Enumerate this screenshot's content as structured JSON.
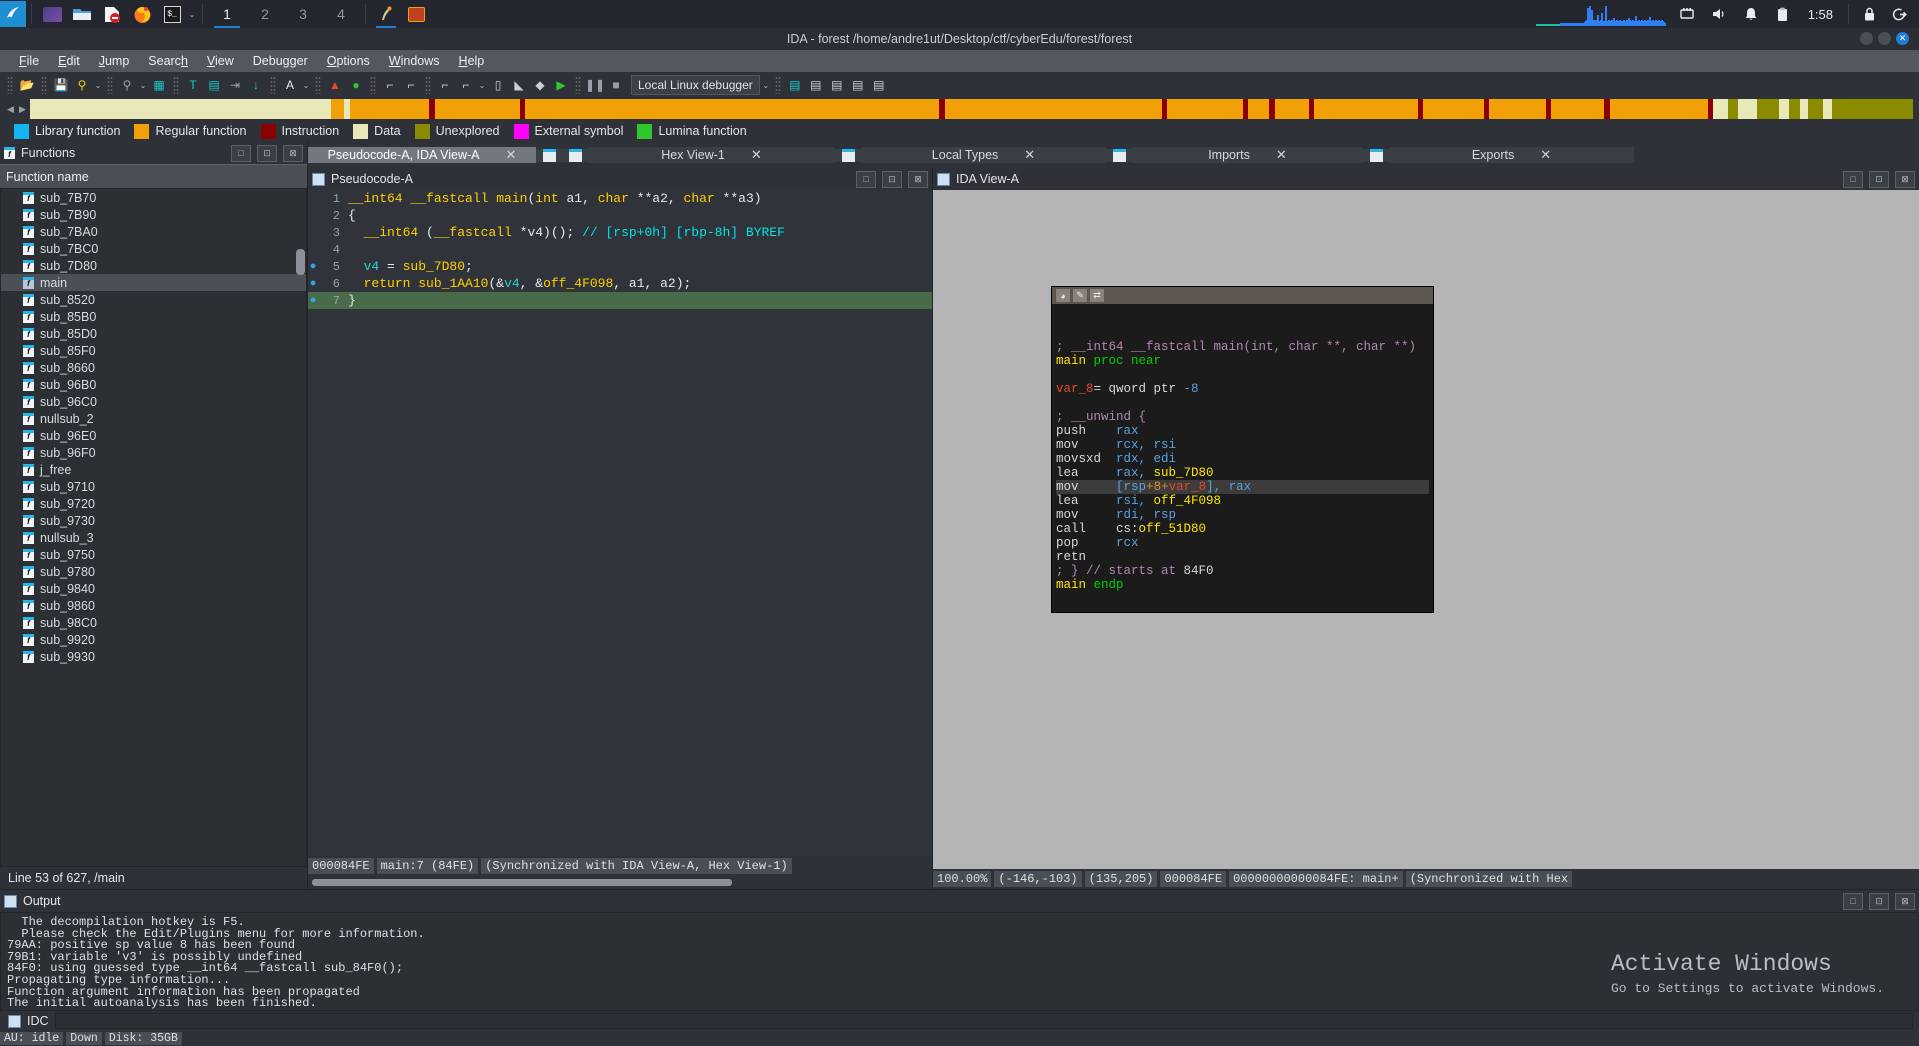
{
  "taskbar": {
    "logo_icon": "kali-dragon-icon",
    "launchers": [
      {
        "name": "terminal-emulator-icon",
        "glyph": "▭"
      },
      {
        "name": "file-manager-icon",
        "glyph": "📁"
      },
      {
        "name": "text-editor-icon",
        "glyph": "📄"
      },
      {
        "name": "firefox-icon",
        "glyph": "🦊"
      },
      {
        "name": "terminal-icon",
        "glyph": "$_"
      }
    ],
    "dropdown_caret": "⌄",
    "workspaces": [
      "1",
      "2",
      "3",
      "4"
    ],
    "active_workspace": "1",
    "app_windows": [
      {
        "name": "ida-window-icon",
        "glyph": "🦅"
      },
      {
        "name": "terminal-window-icon",
        "glyph": "▣"
      }
    ],
    "tray": [
      {
        "name": "network-icon",
        "glyph": "🖧"
      },
      {
        "name": "volume-icon",
        "glyph": "🔊"
      },
      {
        "name": "notifications-bell-icon",
        "glyph": "🔔"
      },
      {
        "name": "clipboard-icon",
        "glyph": "📋"
      }
    ],
    "clock": "1:58",
    "lock_icon": "🔒",
    "logout_icon": "⏻"
  },
  "window": {
    "title": "IDA - forest /home/andre1ut/Desktop/ctf/cyberEdu/forest/forest",
    "minimize": "−",
    "maximize": "□",
    "close": "✕"
  },
  "menu": [
    {
      "label": "File",
      "mnemonic": "F"
    },
    {
      "label": "Edit",
      "mnemonic": "E"
    },
    {
      "label": "Jump",
      "mnemonic": "J"
    },
    {
      "label": "Search",
      "mnemonic": "h"
    },
    {
      "label": "View",
      "mnemonic": "V"
    },
    {
      "label": "Debugger",
      "mnemonic": "g"
    },
    {
      "label": "Options",
      "mnemonic": "O"
    },
    {
      "label": "Windows",
      "mnemonic": "W"
    },
    {
      "label": "Help",
      "mnemonic": "H"
    }
  ],
  "toolbar": {
    "debugger_selector": "Local Linux debugger",
    "items": [
      {
        "name": "open-file-icon",
        "glyph": "📂",
        "color": "#e8a317"
      },
      {
        "name": "save-file-icon",
        "glyph": "💾",
        "color": "#29b6e8"
      },
      {
        "name": "navigate-back-icon",
        "glyph": "⚲",
        "color": "#e8d017"
      },
      {
        "name": "navigate-forward-icon",
        "glyph": "⚲",
        "color": "#9aa0aa"
      },
      {
        "name": "hex-view-icon",
        "glyph": "▦",
        "color": "#17c8c8"
      },
      {
        "name": "text-view-icon",
        "glyph": "T",
        "color": "#17c8c8"
      },
      {
        "name": "structures-icon",
        "glyph": "▤",
        "color": "#17c8c8"
      },
      {
        "name": "exports-icon",
        "glyph": "⇥",
        "color": "#9aa0aa"
      },
      {
        "name": "jump-down-icon",
        "glyph": "↓",
        "color": "#17c8c8"
      },
      {
        "name": "font-icon",
        "glyph": "A",
        "color": "#e8ecf2"
      },
      {
        "name": "breakpoint-icon",
        "glyph": "▲",
        "color": "#e04b2a"
      },
      {
        "name": "run-to-icon",
        "glyph": "●",
        "color": "#2ec82e"
      },
      {
        "name": "step-into-icon",
        "glyph": "⌐",
        "color": "#c9ced6"
      },
      {
        "name": "step-over-icon",
        "glyph": "⌐",
        "color": "#c9ced6"
      },
      {
        "name": "step-out-icon",
        "glyph": "⌐",
        "color": "#c9ced6"
      },
      {
        "name": "run-until-return-icon",
        "glyph": "⌐",
        "color": "#c9ced6"
      },
      {
        "name": "stack-frame-icon",
        "glyph": "▯",
        "color": "#c9ced6"
      },
      {
        "name": "edit-function-icon",
        "glyph": "◣",
        "color": "#c9ced6"
      },
      {
        "name": "xrefs-icon",
        "glyph": "◆",
        "color": "#c9ced6"
      },
      {
        "name": "run-debugger-icon",
        "glyph": "▶",
        "color": "#2ec82e"
      },
      {
        "name": "pause-debugger-icon",
        "glyph": "❚❚",
        "color": "#9aa0aa"
      },
      {
        "name": "stop-debugger-icon",
        "glyph": "■",
        "color": "#9aa0aa"
      }
    ],
    "trailing": [
      {
        "name": "watch-view-icon",
        "glyph": "▤",
        "color": "#17c8c8"
      },
      {
        "name": "module-list-icon",
        "glyph": "▤",
        "color": "#c9ced6"
      },
      {
        "name": "threads-icon",
        "glyph": "▤",
        "color": "#c9ced6"
      },
      {
        "name": "segments-icon",
        "glyph": "▤",
        "color": "#c9ced6"
      },
      {
        "name": "options-icon",
        "glyph": "▤",
        "color": "#c9ced6"
      }
    ]
  },
  "navband": {
    "left_arrow": "◀",
    "right_arrow": "▶",
    "segments": [
      {
        "color": "#e8e8b8",
        "width": 16.0
      },
      {
        "color": "#f2a007",
        "width": 0.7
      },
      {
        "color": "#e8e8b8",
        "width": 0.3
      },
      {
        "color": "#f2a007",
        "width": 4.2
      },
      {
        "color": "#8b0000",
        "width": 0.3
      },
      {
        "color": "#f2a007",
        "width": 4.5
      },
      {
        "color": "#8b0000",
        "width": 0.3
      },
      {
        "color": "#f2a007",
        "width": 22.0
      },
      {
        "color": "#8b0000",
        "width": 0.3
      },
      {
        "color": "#f2a007",
        "width": 11.5
      },
      {
        "color": "#8b0000",
        "width": 0.3
      },
      {
        "color": "#f2a007",
        "width": 4.0
      },
      {
        "color": "#8b0000",
        "width": 0.3
      },
      {
        "color": "#f2a007",
        "width": 1.1
      },
      {
        "color": "#8b0000",
        "width": 0.3
      },
      {
        "color": "#f2a007",
        "width": 1.8
      },
      {
        "color": "#8b0000",
        "width": 0.3
      },
      {
        "color": "#f2a007",
        "width": 5.5
      },
      {
        "color": "#8b0000",
        "width": 0.3
      },
      {
        "color": "#f2a007",
        "width": 3.2
      },
      {
        "color": "#8b0000",
        "width": 0.3
      },
      {
        "color": "#f2a007",
        "width": 3.0
      },
      {
        "color": "#8b0000",
        "width": 0.3
      },
      {
        "color": "#f2a007",
        "width": 2.8
      },
      {
        "color": "#8b0000",
        "width": 0.3
      },
      {
        "color": "#f2a007",
        "width": 5.2
      },
      {
        "color": "#8b0000",
        "width": 0.3
      },
      {
        "color": "#e8e8b8",
        "width": 0.8
      },
      {
        "color": "#8b8b00",
        "width": 0.5
      },
      {
        "color": "#e8e8b8",
        "width": 1.0
      },
      {
        "color": "#8b8b00",
        "width": 1.2
      },
      {
        "color": "#e8e8b8",
        "width": 0.5
      },
      {
        "color": "#8b8b00",
        "width": 0.6
      },
      {
        "color": "#e8e8b8",
        "width": 0.4
      },
      {
        "color": "#8b8b00",
        "width": 0.8
      },
      {
        "color": "#e8e8b8",
        "width": 0.5
      },
      {
        "color": "#8b8b00",
        "width": 9.0
      },
      {
        "color": "#e8e8b8",
        "width": 0.4
      },
      {
        "color": "#8b8b00",
        "width": 0.7
      },
      {
        "color": "#e8e8b8",
        "width": 0.3
      },
      {
        "color": "#8b8b00",
        "width": 0.6
      },
      {
        "color": "#e8e8b8",
        "width": 0.9
      },
      {
        "color": "#8b8b00",
        "width": 0.5
      },
      {
        "color": "#ff00ff",
        "width": 0.6
      },
      {
        "color": "#2e3137",
        "width": 50.0
      }
    ],
    "cursor_pos_pct": 22.6
  },
  "legend": [
    {
      "label": "Library function",
      "color": "#12b5f0"
    },
    {
      "label": "Regular function",
      "color": "#f2a007"
    },
    {
      "label": "Instruction",
      "color": "#8b0000"
    },
    {
      "label": "Data",
      "color": "#e8e8b8"
    },
    {
      "label": "Unexplored",
      "color": "#8b8b00"
    },
    {
      "label": "External symbol",
      "color": "#ff00ff"
    },
    {
      "label": "Lumina function",
      "color": "#2ec82e"
    }
  ],
  "functions_panel": {
    "title": "Functions",
    "title_icon": "function-icon",
    "column_header": "Function name",
    "buttons": [
      {
        "name": "maximize-panel-button",
        "glyph": "□"
      },
      {
        "name": "detach-panel-button",
        "glyph": "⊡"
      },
      {
        "name": "close-panel-button",
        "glyph": "⊠"
      }
    ],
    "items": [
      "sub_7B70",
      "sub_7B90",
      "sub_7BA0",
      "sub_7BC0",
      "sub_7D80",
      "main",
      "sub_8520",
      "sub_85B0",
      "sub_85D0",
      "sub_85F0",
      "sub_8660",
      "sub_96B0",
      "sub_96C0",
      "nullsub_2",
      "sub_96E0",
      "sub_96F0",
      "j_free",
      "sub_9710",
      "sub_9720",
      "sub_9730",
      "nullsub_3",
      "sub_9750",
      "sub_9780",
      "sub_9840",
      "sub_9860",
      "sub_98C0",
      "sub_9920",
      "sub_9930"
    ],
    "selected": "main",
    "status": "Line 53 of 627, /main"
  },
  "tabs": [
    {
      "label": "Pseudocode-A, IDA View-A",
      "active": true,
      "closable": true,
      "icon": "pseudocode-icon"
    },
    {
      "label": "Hex View-1",
      "active": false,
      "closable": true,
      "icon": "hex-view-icon"
    },
    {
      "label": "Local Types",
      "active": false,
      "closable": true,
      "icon": "local-types-icon"
    },
    {
      "label": "Imports",
      "active": false,
      "closable": true,
      "icon": "imports-icon"
    },
    {
      "label": "Exports",
      "active": false,
      "closable": true,
      "icon": "exports-icon"
    }
  ],
  "pseudocode": {
    "panel_title": "Pseudocode-A",
    "panel_icon": "pseudocode-icon",
    "buttons": [
      {
        "name": "maximize-pane-button",
        "glyph": "□"
      },
      {
        "name": "detach-pane-button",
        "glyph": "⊡"
      },
      {
        "name": "close-pane-button",
        "glyph": "⊠"
      }
    ],
    "lines": [
      {
        "n": "1",
        "bp": false,
        "hl": false,
        "segs": [
          {
            "t": "__int64 __fastcall ",
            "c": "kw"
          },
          {
            "t": "main",
            "c": "nm"
          },
          {
            "t": "(",
            "c": "pl"
          },
          {
            "t": "int",
            "c": "kw"
          },
          {
            "t": " a1, ",
            "c": "pl"
          },
          {
            "t": "char",
            "c": "kw"
          },
          {
            "t": " **a2, ",
            "c": "pl"
          },
          {
            "t": "char",
            "c": "kw"
          },
          {
            "t": " **a3)",
            "c": "pl"
          }
        ]
      },
      {
        "n": "2",
        "bp": false,
        "hl": false,
        "segs": [
          {
            "t": "{",
            "c": "pl"
          }
        ]
      },
      {
        "n": "3",
        "bp": false,
        "hl": false,
        "segs": [
          {
            "t": "  ",
            "c": "pl"
          },
          {
            "t": "__int64",
            "c": "kw"
          },
          {
            "t": " (",
            "c": "pl"
          },
          {
            "t": "__fastcall",
            "c": "kw"
          },
          {
            "t": " *v4)(); ",
            "c": "pl"
          },
          {
            "t": "// [rsp+0h] [rbp-8h] BYREF",
            "c": "cm"
          }
        ]
      },
      {
        "n": "4",
        "bp": false,
        "hl": false,
        "segs": [
          {
            "t": "",
            "c": "pl"
          }
        ]
      },
      {
        "n": "5",
        "bp": true,
        "hl": false,
        "segs": [
          {
            "t": "  ",
            "c": "pl"
          },
          {
            "t": "v4",
            "c": "vr"
          },
          {
            "t": " = ",
            "c": "pl"
          },
          {
            "t": "sub_7D80",
            "c": "nm"
          },
          {
            "t": ";",
            "c": "pl"
          }
        ]
      },
      {
        "n": "6",
        "bp": true,
        "hl": false,
        "segs": [
          {
            "t": "  ",
            "c": "pl"
          },
          {
            "t": "return",
            "c": "kw"
          },
          {
            "t": " ",
            "c": "pl"
          },
          {
            "t": "sub_1AA10",
            "c": "nm"
          },
          {
            "t": "(&",
            "c": "pl"
          },
          {
            "t": "v4",
            "c": "vr"
          },
          {
            "t": ", &",
            "c": "pl"
          },
          {
            "t": "off_4F098",
            "c": "nm"
          },
          {
            "t": ", a1, a2);",
            "c": "pl"
          }
        ]
      },
      {
        "n": "7",
        "bp": true,
        "hl": true,
        "segs": [
          {
            "t": "}",
            "c": "pl"
          }
        ]
      }
    ],
    "status_segments": [
      "000084FE",
      "main:7 (84FE)",
      "(Synchronized with IDA View-A, Hex View-1)"
    ]
  },
  "ida_view": {
    "panel_title": "IDA View-A",
    "panel_icon": "ida-view-icon",
    "buttons": [
      {
        "name": "maximize-pane-button",
        "glyph": "□"
      },
      {
        "name": "detach-pane-button",
        "glyph": "⊡"
      },
      {
        "name": "close-pane-button",
        "glyph": "⊠"
      }
    ],
    "node_toolbar": [
      {
        "name": "node-color-icon",
        "glyph": "◕"
      },
      {
        "name": "node-edit-icon",
        "glyph": "✎"
      },
      {
        "name": "node-group-icon",
        "glyph": "⇄"
      }
    ],
    "disasm": [
      {
        "hl": false,
        "segs": [
          {
            "t": "",
            "c": "wht"
          }
        ]
      },
      {
        "hl": false,
        "segs": [
          {
            "t": "",
            "c": "wht"
          }
        ]
      },
      {
        "hl": false,
        "segs": [
          {
            "t": "; __int64 __fastcall main(int, char **, char **)",
            "c": "cmt"
          }
        ]
      },
      {
        "hl": false,
        "segs": [
          {
            "t": "main",
            "c": "ylw"
          },
          {
            "t": " ",
            "c": "wht"
          },
          {
            "t": "proc near",
            "c": "grn"
          }
        ]
      },
      {
        "hl": false,
        "segs": [
          {
            "t": "",
            "c": "wht"
          }
        ]
      },
      {
        "hl": false,
        "segs": [
          {
            "t": "var_8",
            "c": "red"
          },
          {
            "t": "= qword ptr ",
            "c": "wht"
          },
          {
            "t": "-8",
            "c": "blu"
          }
        ]
      },
      {
        "hl": false,
        "segs": [
          {
            "t": "",
            "c": "wht"
          }
        ]
      },
      {
        "hl": false,
        "segs": [
          {
            "t": "; __unwind {",
            "c": "cmt"
          }
        ]
      },
      {
        "hl": false,
        "segs": [
          {
            "t": "push    ",
            "c": "wht"
          },
          {
            "t": "rax",
            "c": "blu"
          }
        ]
      },
      {
        "hl": false,
        "segs": [
          {
            "t": "mov     ",
            "c": "wht"
          },
          {
            "t": "rcx, rsi",
            "c": "blu"
          }
        ]
      },
      {
        "hl": false,
        "segs": [
          {
            "t": "movsxd  ",
            "c": "wht"
          },
          {
            "t": "rdx, edi",
            "c": "blu"
          }
        ]
      },
      {
        "hl": false,
        "segs": [
          {
            "t": "lea     ",
            "c": "wht"
          },
          {
            "t": "rax, ",
            "c": "blu"
          },
          {
            "t": "sub_7D80",
            "c": "ylw"
          }
        ]
      },
      {
        "hl": true,
        "segs": [
          {
            "t": "mov     ",
            "c": "wht"
          },
          {
            "t": "[",
            "c": "blu"
          },
          {
            "t": "rsp",
            "c": "blu"
          },
          {
            "t": "+",
            "c": "org"
          },
          {
            "t": "8",
            "c": "org"
          },
          {
            "t": "+",
            "c": "org"
          },
          {
            "t": "var_8",
            "c": "red"
          },
          {
            "t": "], rax",
            "c": "blu"
          }
        ]
      },
      {
        "hl": false,
        "segs": [
          {
            "t": "lea     ",
            "c": "wht"
          },
          {
            "t": "rsi, ",
            "c": "blu"
          },
          {
            "t": "off_4F098",
            "c": "ylw"
          }
        ]
      },
      {
        "hl": false,
        "segs": [
          {
            "t": "mov     ",
            "c": "wht"
          },
          {
            "t": "rdi, rsp",
            "c": "blu"
          }
        ]
      },
      {
        "hl": false,
        "segs": [
          {
            "t": "call    ",
            "c": "wht"
          },
          {
            "t": "cs:",
            "c": "wht"
          },
          {
            "t": "off_51D80",
            "c": "ylw"
          }
        ]
      },
      {
        "hl": false,
        "segs": [
          {
            "t": "pop     ",
            "c": "wht"
          },
          {
            "t": "rcx",
            "c": "blu"
          }
        ]
      },
      {
        "hl": false,
        "segs": [
          {
            "t": "retn",
            "c": "wht"
          }
        ]
      },
      {
        "hl": false,
        "segs": [
          {
            "t": "; } // starts at ",
            "c": "cmt"
          },
          {
            "t": "84F0",
            "c": "wht"
          }
        ]
      },
      {
        "hl": false,
        "segs": [
          {
            "t": "main",
            "c": "ylw"
          },
          {
            "t": " ",
            "c": "wht"
          },
          {
            "t": "endp",
            "c": "grn"
          }
        ]
      }
    ],
    "status_segments": [
      "100.00%",
      "(-146,-103)",
      "(135,205)",
      "000084FE",
      "00000000000084FE: main+",
      "(Synchronized with Hex"
    ]
  },
  "output": {
    "title": "Output",
    "title_icon": "output-icon",
    "buttons": [
      {
        "name": "maximize-output-button",
        "glyph": "□"
      },
      {
        "name": "detach-output-button",
        "glyph": "⊡"
      },
      {
        "name": "close-output-button",
        "glyph": "⊠"
      }
    ],
    "lines": [
      "  The decompilation hotkey is F5.",
      "  Please check the Edit/Plugins menu for more information.",
      "79AA: positive sp value 8 has been found",
      "79B1: variable 'v3' is possibly undefined",
      "84F0: using guessed type __int64 __fastcall sub_84F0();",
      "Propagating type information...",
      "Function argument information has been propagated",
      "The initial autoanalysis has been finished."
    ],
    "input_label": "IDC"
  },
  "watermark": {
    "line1": "Activate Windows",
    "line2": "Go to Settings to activate Windows."
  },
  "bottom_status": {
    "segments": [
      "AU: idle",
      "Down",
      "Disk: 35GB"
    ]
  }
}
